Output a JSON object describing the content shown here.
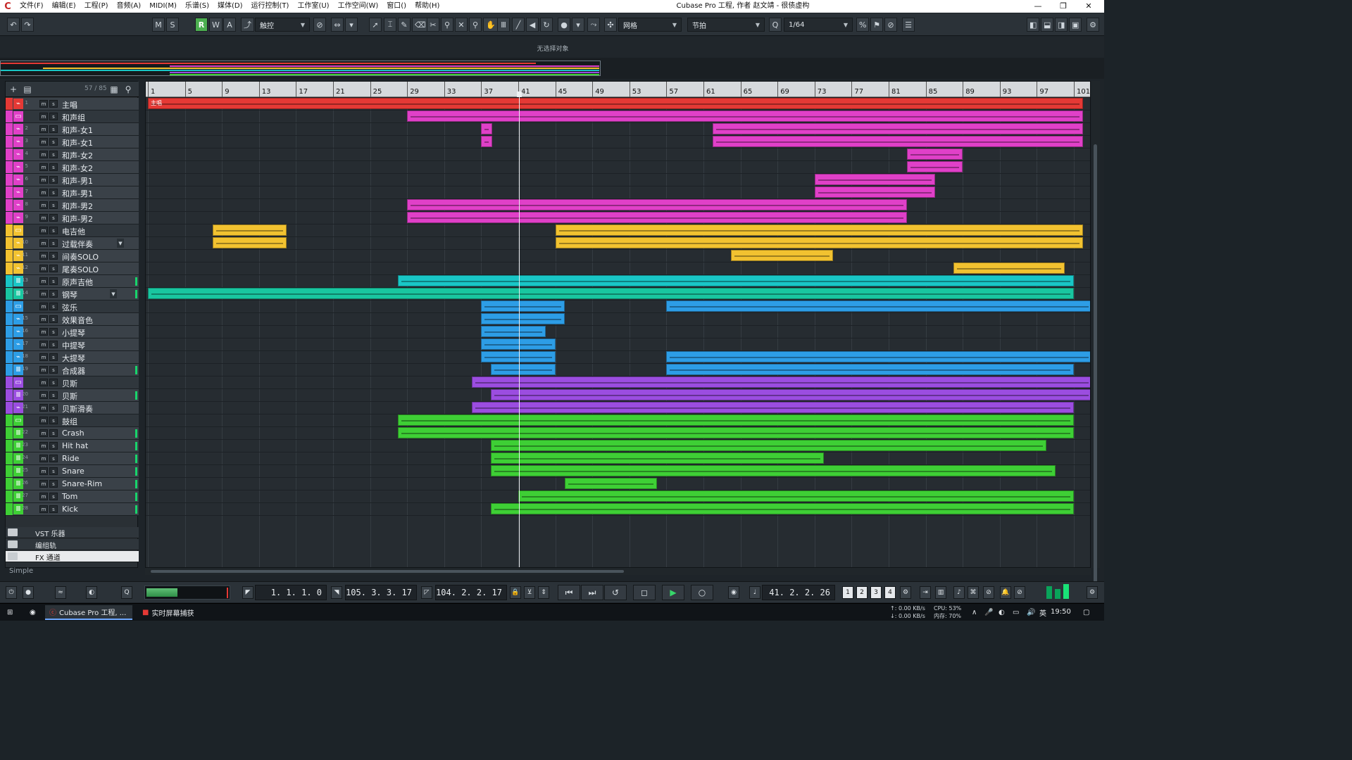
{
  "menubar": {
    "items": [
      "文件(F)",
      "编辑(E)",
      "工程(P)",
      "音频(A)",
      "MIDI(M)",
      "乐谱(S)",
      "媒体(D)",
      "运行控制(T)",
      "工作室(U)",
      "工作空间(W)",
      "窗口()",
      "帮助(H)"
    ],
    "title": "Cubase Pro 工程, 作者 赵文靖 - 很债虚构",
    "minimize": "—",
    "maximize": "❐",
    "close": "✕"
  },
  "toolbar": {
    "undo": "↶",
    "redo": "↷",
    "m": "M",
    "s": "S",
    "r": "R",
    "w": "W",
    "a": "A",
    "automation_mode": "触控",
    "snap_type": "网格",
    "grid_type": "节拍",
    "quantize": "1/64"
  },
  "infoline": {
    "no_selection": "无选择对象"
  },
  "tracklist": {
    "count": "57 / 85",
    "preset_label": "Simple",
    "tracks": [
      {
        "num": "1",
        "name": "主唱",
        "color": "#e53935",
        "type": "audio"
      },
      {
        "num": "",
        "name": "和声组",
        "color": "#e040c8",
        "type": "folder"
      },
      {
        "num": "2",
        "name": "和声-女1",
        "color": "#e040c8",
        "type": "audio"
      },
      {
        "num": "3",
        "name": "和声-女1",
        "color": "#e040c8",
        "type": "audio"
      },
      {
        "num": "4",
        "name": "和声-女2",
        "color": "#e040c8",
        "type": "audio"
      },
      {
        "num": "5",
        "name": "和声-女2",
        "color": "#e040c8",
        "type": "audio"
      },
      {
        "num": "6",
        "name": "和声-男1",
        "color": "#e040c8",
        "type": "audio"
      },
      {
        "num": "7",
        "name": "和声-男1",
        "color": "#e040c8",
        "type": "audio"
      },
      {
        "num": "8",
        "name": "和声-男2",
        "color": "#e040c8",
        "type": "audio"
      },
      {
        "num": "9",
        "name": "和声-男2",
        "color": "#e040c8",
        "type": "audio"
      },
      {
        "num": "",
        "name": "电吉他",
        "color": "#f2c230",
        "type": "folder"
      },
      {
        "num": "10",
        "name": "过载伴奏",
        "color": "#f2c230",
        "type": "audio"
      },
      {
        "num": "11",
        "name": "间奏SOLO",
        "color": "#f2c230",
        "type": "audio"
      },
      {
        "num": "12",
        "name": "尾奏SOLO",
        "color": "#f2c230",
        "type": "audio"
      },
      {
        "num": "13",
        "name": "原声吉他",
        "color": "#19c6c6",
        "type": "instrument"
      },
      {
        "num": "14",
        "name": "钢琴",
        "color": "#19c6a0",
        "type": "instrument"
      },
      {
        "num": "",
        "name": "弦乐",
        "color": "#2d9de6",
        "type": "folder"
      },
      {
        "num": "15",
        "name": "效果音色",
        "color": "#2d9de6",
        "type": "audio"
      },
      {
        "num": "16",
        "name": "小提琴",
        "color": "#2d9de6",
        "type": "audio"
      },
      {
        "num": "17",
        "name": "中提琴",
        "color": "#2d9de6",
        "type": "audio"
      },
      {
        "num": "18",
        "name": "大提琴",
        "color": "#2d9de6",
        "type": "audio"
      },
      {
        "num": "19",
        "name": "合成器",
        "color": "#2d9de6",
        "type": "instrument"
      },
      {
        "num": "",
        "name": "贝斯",
        "color": "#9b4de0",
        "type": "folder"
      },
      {
        "num": "20",
        "name": "贝斯",
        "color": "#9b4de0",
        "type": "instrument"
      },
      {
        "num": "21",
        "name": "贝斯滑奏",
        "color": "#9b4de0",
        "type": "audio"
      },
      {
        "num": "",
        "name": "鼓组",
        "color": "#3ecf35",
        "type": "folder"
      },
      {
        "num": "22",
        "name": "Crash",
        "color": "#3ecf35",
        "type": "instrument"
      },
      {
        "num": "23",
        "name": "Hit hat",
        "color": "#3ecf35",
        "type": "instrument"
      },
      {
        "num": "24",
        "name": "Ride",
        "color": "#3ecf35",
        "type": "instrument"
      },
      {
        "num": "25",
        "name": "Snare",
        "color": "#3ecf35",
        "type": "instrument"
      },
      {
        "num": "26",
        "name": "Snare-Rim",
        "color": "#3ecf35",
        "type": "instrument"
      },
      {
        "num": "27",
        "name": "Tom",
        "color": "#3ecf35",
        "type": "instrument"
      },
      {
        "num": "28",
        "name": "Kick",
        "color": "#3ecf35",
        "type": "instrument"
      }
    ],
    "bottom": [
      {
        "name": "VST 乐器"
      },
      {
        "name": "编组轨"
      },
      {
        "name": "FX 通道"
      }
    ]
  },
  "ruler": {
    "bars": [
      "1",
      "5",
      "9",
      "13",
      "17",
      "21",
      "25",
      "29",
      "33",
      "37",
      "41",
      "45",
      "49",
      "53",
      "57",
      "61",
      "65",
      "69",
      "73",
      "77",
      "81",
      "85",
      "89",
      "93",
      "97",
      "101"
    ]
  },
  "events_label": "主唱",
  "transport": {
    "left_locator": "1. 1. 1.   0",
    "right_locator": "105. 3. 3. 17",
    "punch_range": "104. 2. 2. 17",
    "position": "41. 2. 2. 26",
    "loop_markers": [
      "1",
      "2",
      "3",
      "4"
    ]
  },
  "taskbar": {
    "app1": "Cubase Pro 工程, ...",
    "app2": "实时屏幕捕获",
    "disk_read": "↑: 0.00 KB/s",
    "disk_write": "↓: 0.00 KB/s",
    "cpu": "CPU: 53%",
    "mem": "内存: 70%",
    "ime": "英",
    "time": "19:50"
  }
}
